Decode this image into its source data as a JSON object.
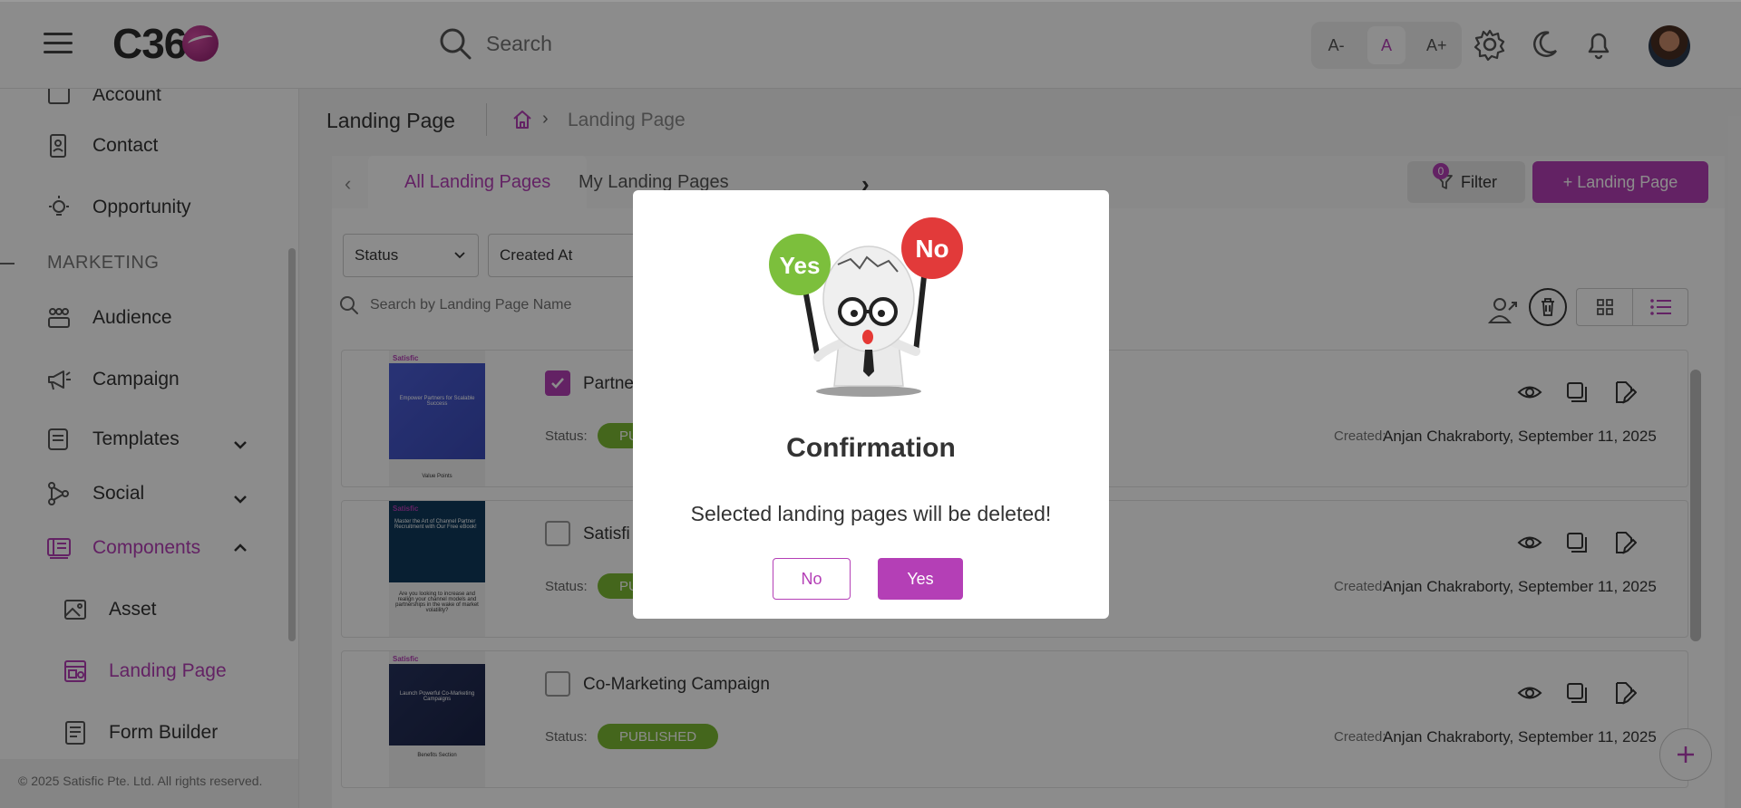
{
  "header": {
    "logo_text": "C36",
    "search_placeholder": "Search",
    "font_decrease": "A-",
    "font_normal": "A",
    "font_increase": "A+"
  },
  "sidebar": {
    "items": [
      {
        "label": "Account",
        "icon": "account-icon"
      },
      {
        "label": "Contact",
        "icon": "contact-icon"
      },
      {
        "label": "Opportunity",
        "icon": "lightbulb-icon"
      }
    ],
    "section": "MARKETING",
    "marketing": [
      {
        "label": "Audience",
        "icon": "audience-icon"
      },
      {
        "label": "Campaign",
        "icon": "megaphone-icon"
      },
      {
        "label": "Templates",
        "icon": "templates-icon",
        "expandable": true
      },
      {
        "label": "Social",
        "icon": "social-icon",
        "expandable": true
      },
      {
        "label": "Components",
        "icon": "components-icon",
        "expanded": true
      }
    ],
    "components_sub": [
      {
        "label": "Asset",
        "icon": "image-icon"
      },
      {
        "label": "Landing Page",
        "icon": "landing-page-icon"
      },
      {
        "label": "Form Builder",
        "icon": "form-icon"
      }
    ],
    "footer": "© 2025 Satisfic Pte. Ltd. All rights reserved."
  },
  "main": {
    "title": "Landing Page",
    "breadcrumb_current": "Landing Page",
    "tabs": [
      {
        "label": "All Landing Pages",
        "active": true
      },
      {
        "label": "My Landing Pages",
        "active": false
      }
    ],
    "filter_label": "Filter",
    "filter_count": "0",
    "add_label": "+ Landing Page",
    "filters": {
      "status": "Status",
      "created_at": "Created At"
    },
    "list_search_placeholder": "Search by Landing Page Name",
    "cards": [
      {
        "name": "Partne",
        "checked": true,
        "status_label": "Status:",
        "status": "PUBLISHED",
        "status_visible": "PU",
        "created_label": "Created:",
        "created": "Anjan Chakraborty, September 11, 2025",
        "thumb_brand": "Satisfic",
        "thumb_caption": "Empower Partners for Scalable Success",
        "thumb_footer": "Value Points"
      },
      {
        "name": "Satisfi",
        "checked": false,
        "status_label": "Status:",
        "status": "PUBLISHED",
        "status_visible": "PU",
        "created_label": "Created:",
        "created": "Anjan Chakraborty, September 11, 2025",
        "thumb_brand": "Satisfic",
        "thumb_caption": "Master the Art of Channel Partner Recruitment with Our Free eBook!",
        "thumb_footer": "Are you looking to increase and realign your channel models and partnerships in the wake of market volatility?"
      },
      {
        "name": "Co-Marketing Campaign",
        "checked": false,
        "status_label": "Status:",
        "status": "PUBLISHED",
        "status_visible": "PUBLISHED",
        "created_label": "Created:",
        "created": "Anjan Chakraborty, September 11, 2025",
        "thumb_brand": "Satisfic",
        "thumb_caption": "Launch Powerful Co-Marketing Campaigns",
        "thumb_footer": "Benefits Section"
      }
    ]
  },
  "modal": {
    "sign_yes": "Yes",
    "sign_no": "No",
    "title": "Confirmation",
    "message": "Selected landing pages will be deleted!",
    "no_label": "No",
    "yes_label": "Yes"
  },
  "colors": {
    "accent": "#b43fb6",
    "published": "#7dbb33",
    "overlay": "rgba(0,0,0,0.45)"
  }
}
